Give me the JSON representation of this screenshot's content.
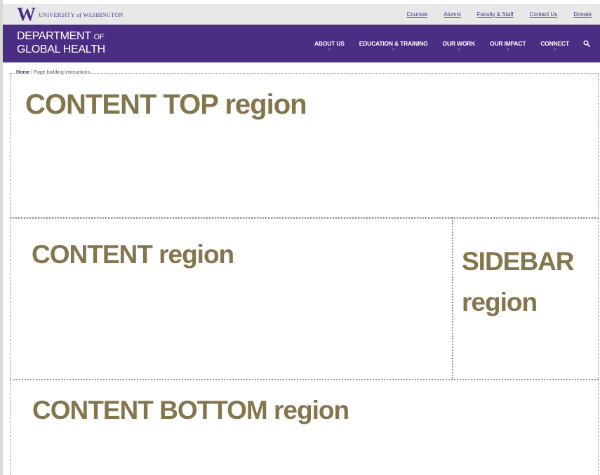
{
  "uw_bar": {
    "logo_letter": "W",
    "university_pre": "UNIVERSITY ",
    "university_of": "of",
    "university_post": " WASHINGTON",
    "links": [
      "Courses",
      "Alumni",
      "Faculty & Staff",
      "Contact Us",
      "Donate"
    ]
  },
  "department": {
    "title_line1_main": "DEPARTMENT ",
    "title_line1_small": "OF",
    "title_line2": "GLOBAL HEALTH"
  },
  "nav": {
    "items": [
      "ABOUT US",
      "EDUCATION & TRAINING",
      "OUR WORK",
      "OUR IMPACT",
      "CONNECT"
    ],
    "caret": "˅",
    "search_icon": "search-icon"
  },
  "breadcrumb": {
    "home": "Home",
    "separator": " / ",
    "current": "Page building instructions"
  },
  "regions": {
    "content_top": "CONTENT TOP region",
    "content": "CONTENT region",
    "sidebar": "SIDEBAR region",
    "content_bottom": "CONTENT BOTTOM region"
  },
  "colors": {
    "uw_purple": "#4b2e83",
    "region_gold": "#85754d",
    "utility_bar": "#e8e8e8"
  }
}
